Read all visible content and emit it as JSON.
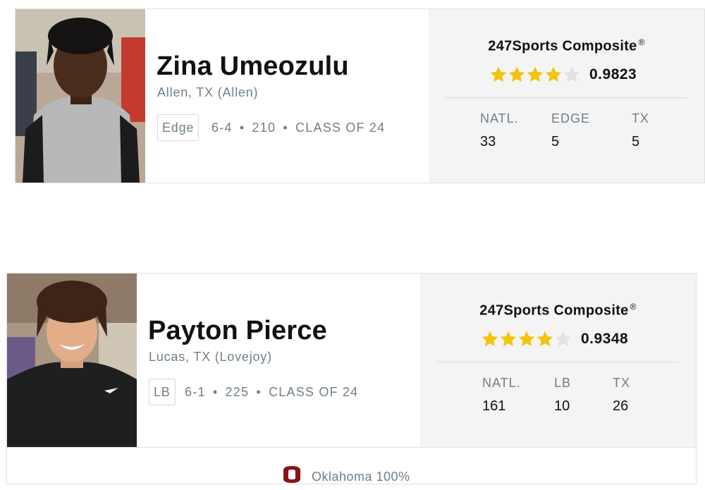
{
  "composite_title": "247Sports Composite",
  "composite_reg": "®",
  "prospects": [
    {
      "name": "Zina Umeozulu",
      "hometown": "Allen, TX (Allen)",
      "position": "Edge",
      "height": "6-4",
      "weight": "210",
      "class": "CLASS OF 24",
      "stars": 4,
      "max_stars": 5,
      "score": "0.9823",
      "ranks": [
        {
          "label": "NATL.",
          "value": "33"
        },
        {
          "label": "EDGE",
          "value": "5"
        },
        {
          "label": "TX",
          "value": "5"
        }
      ]
    },
    {
      "name": "Payton Pierce",
      "hometown": "Lucas, TX (Lovejoy)",
      "position": "LB",
      "height": "6-1",
      "weight": "225",
      "class": "CLASS OF 24",
      "stars": 4,
      "max_stars": 5,
      "score": "0.9348",
      "ranks": [
        {
          "label": "NATL.",
          "value": "161"
        },
        {
          "label": "LB",
          "value": "10"
        },
        {
          "label": "TX",
          "value": "26"
        }
      ],
      "commitment": {
        "icon": "oklahoma-logo-icon",
        "text": "Oklahoma 100%"
      }
    }
  ],
  "separator": "•",
  "colors": {
    "star_filled": "#f2c40e",
    "star_empty": "#e2e2e2",
    "muted_text": "#6f7f89",
    "panel_bg": "#f4f4f4",
    "oklahoma_crimson": "#841617"
  }
}
